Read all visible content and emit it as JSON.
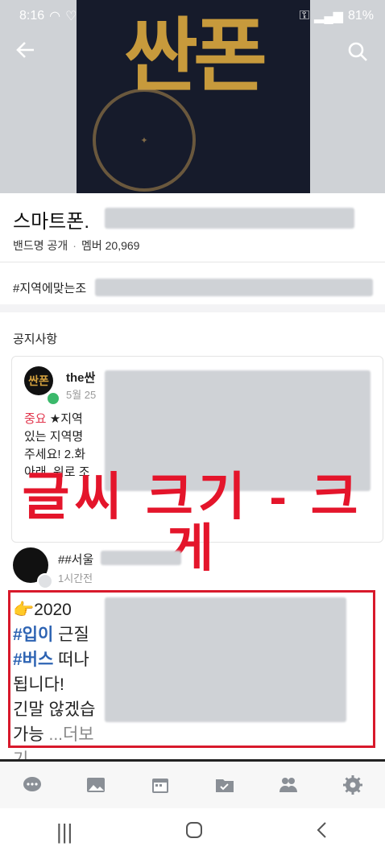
{
  "status_bar": {
    "time": "8:16",
    "battery": "81%"
  },
  "cover": {
    "title_text": "싼폰"
  },
  "band": {
    "name": "스마트폰.",
    "visibility": "밴드명 공개",
    "members": "멤버 20,969",
    "hashtag": "#지역에맞는조"
  },
  "notice": {
    "section_title": "공지사항",
    "author": "the싼",
    "date": "5월 25",
    "body_label": "중요",
    "body_line1": "★지역",
    "body_line2": "있는 지역명",
    "body_line3": "주세요! 2.화",
    "body_line4": "아래, 위로 조"
  },
  "caption": "글씨 크기 - 크게",
  "post": {
    "author": "##서울",
    "time": "1시간전",
    "line1": "👉2020 ",
    "tag1": "#입이",
    "line2_rest": " 근질",
    "tag2": "#버스",
    "line3_rest": " 떠나",
    "line4": "됩니다!",
    "line5": "긴말 않겠습",
    "line6": "가능 ",
    "more": "...더보기"
  },
  "icons": {
    "back": "back-arrow-icon",
    "search": "search-icon",
    "tabs": [
      "chat-icon",
      "photo-icon",
      "calendar-icon",
      "folder-check-icon",
      "members-icon",
      "settings-icon"
    ],
    "sysnav": [
      "recent-apps-icon",
      "home-icon",
      "back-nav-icon"
    ]
  },
  "colors": {
    "accent_red": "#d8192b",
    "tag_blue": "#2e64b3",
    "badge_green": "#3bb96b"
  }
}
